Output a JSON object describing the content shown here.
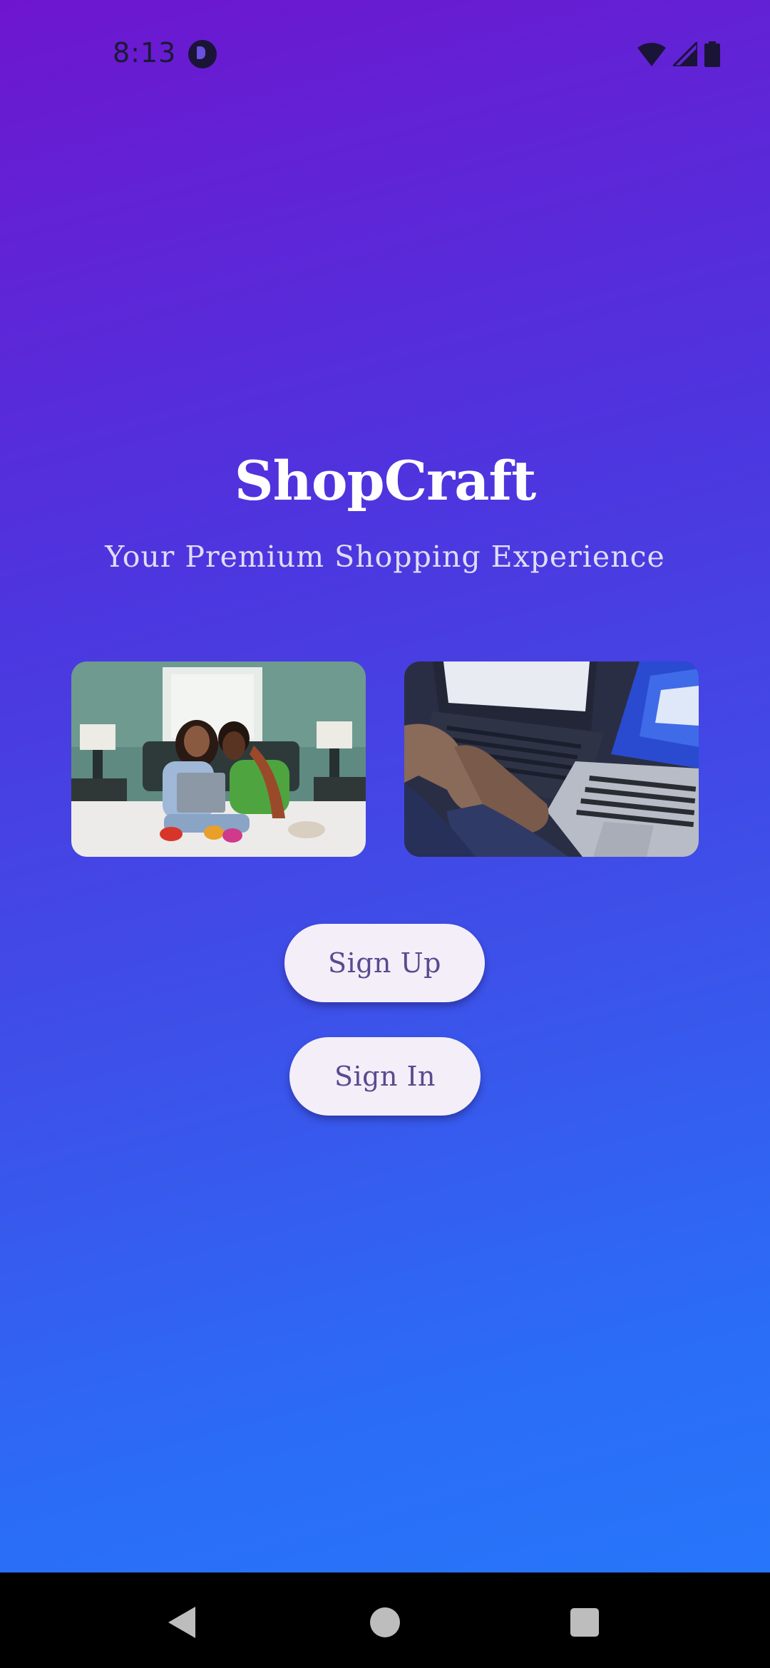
{
  "status_bar": {
    "time": "8:13",
    "app_icon": "notification-app-icon",
    "icons": [
      "wifi-icon",
      "cell-signal-icon",
      "battery-icon"
    ]
  },
  "brand": {
    "title": "ShopCraft",
    "subtitle": "Your Premium Shopping Experience"
  },
  "photos": [
    {
      "name": "two-women-laptop-on-bed-photo"
    },
    {
      "name": "hands-typing-on-laptops-photo"
    }
  ],
  "actions": {
    "sign_up_label": "Sign Up",
    "sign_in_label": "Sign In"
  },
  "nav_bar": {
    "buttons": [
      "back-icon",
      "home-icon",
      "recents-icon"
    ]
  },
  "colors": {
    "gradient_top": "#6e16cf",
    "gradient_bottom": "#2776fa",
    "button_bg": "#f4eef9",
    "button_text": "#5a4a8e",
    "title_text": "#ffffff"
  }
}
